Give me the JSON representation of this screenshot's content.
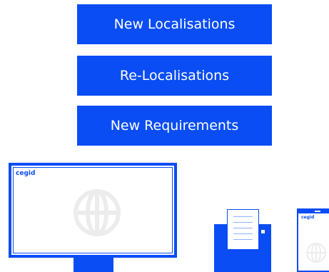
{
  "menu": {
    "new_localisations": "New Localisations",
    "re_localisations": "Re-Localisations",
    "new_requirements": "New Requirements"
  },
  "devices": {
    "monitor_logo": "cegid",
    "phone_logo": "cegid"
  },
  "colors": {
    "brand_blue": "#0a4df5",
    "globe_gray": "#eeeeee"
  },
  "icons": [
    "globe-icon",
    "document-icon",
    "printer-icon",
    "monitor-icon",
    "phone-icon"
  ]
}
